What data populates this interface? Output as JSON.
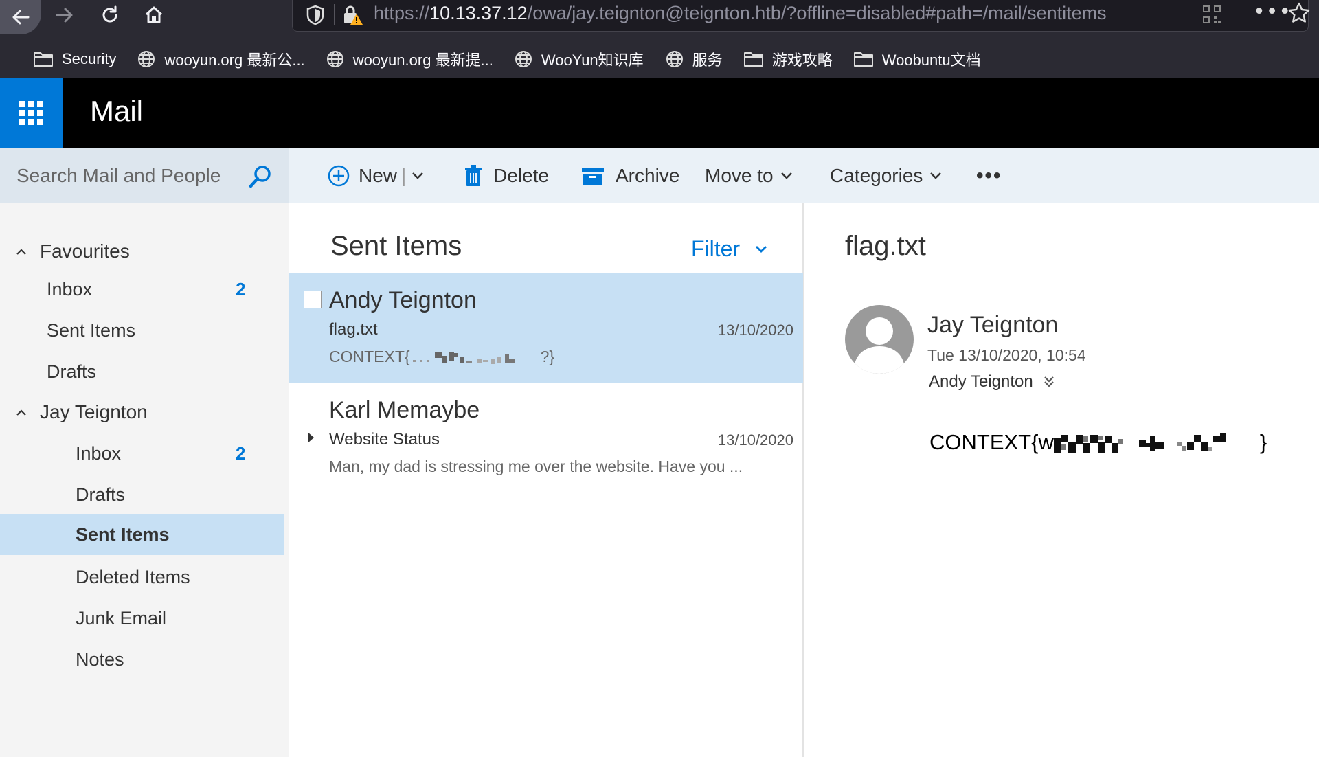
{
  "browser": {
    "url_scheme": "https://",
    "url_host": "10.13.37.12",
    "url_path": "/owa/jay.teignton@teignton.htb/?offline=disabled#path=/mail/sentitems",
    "more_label": "•••",
    "bookmarks": [
      {
        "label": "Security",
        "icon": "folder-icon"
      },
      {
        "label": "wooyun.org 最新公...",
        "icon": "globe-icon"
      },
      {
        "label": "wooyun.org 最新提...",
        "icon": "globe-icon"
      },
      {
        "label": "WooYun知识库",
        "icon": "globe-icon"
      },
      {
        "label": "服务",
        "icon": "globe-icon"
      },
      {
        "label": "游戏攻略",
        "icon": "folder-icon"
      },
      {
        "label": "Woobuntu文档",
        "icon": "folder-icon"
      }
    ]
  },
  "app": {
    "title": "Mail",
    "accent": "#0078d7"
  },
  "search": {
    "placeholder": "Search Mail and People"
  },
  "commands": {
    "new": "New",
    "delete": "Delete",
    "archive": "Archive",
    "move_to": "Move to",
    "categories": "Categories",
    "more": "•••"
  },
  "folders": {
    "favourites": "Favourites",
    "fav_inbox": "Inbox",
    "fav_inbox_count": "2",
    "fav_sent": "Sent Items",
    "fav_drafts": "Drafts",
    "account": "Jay Teignton",
    "inbox": "Inbox",
    "inbox_count": "2",
    "drafts": "Drafts",
    "sent": "Sent Items",
    "deleted": "Deleted Items",
    "junk": "Junk Email",
    "notes": "Notes"
  },
  "message_list": {
    "title": "Sent Items",
    "filter": "Filter",
    "messages": [
      {
        "sender": "Andy Teignton",
        "subject": "flag.txt",
        "date": "13/10/2020",
        "preview": "CONTEXT{",
        "preview_end": "?}"
      },
      {
        "sender": "Karl Memaybe",
        "subject": "Website Status",
        "date": "13/10/2020",
        "preview": "Man, my dad is stressing me over the website. Have you ..."
      }
    ]
  },
  "reading": {
    "subject": "flag.txt",
    "sender": "Jay Teignton",
    "date": "Tue 13/10/2020, 10:54",
    "recipient": "Andy Teignton",
    "body_start": "CONTEXT{w",
    "body_end": "}"
  }
}
